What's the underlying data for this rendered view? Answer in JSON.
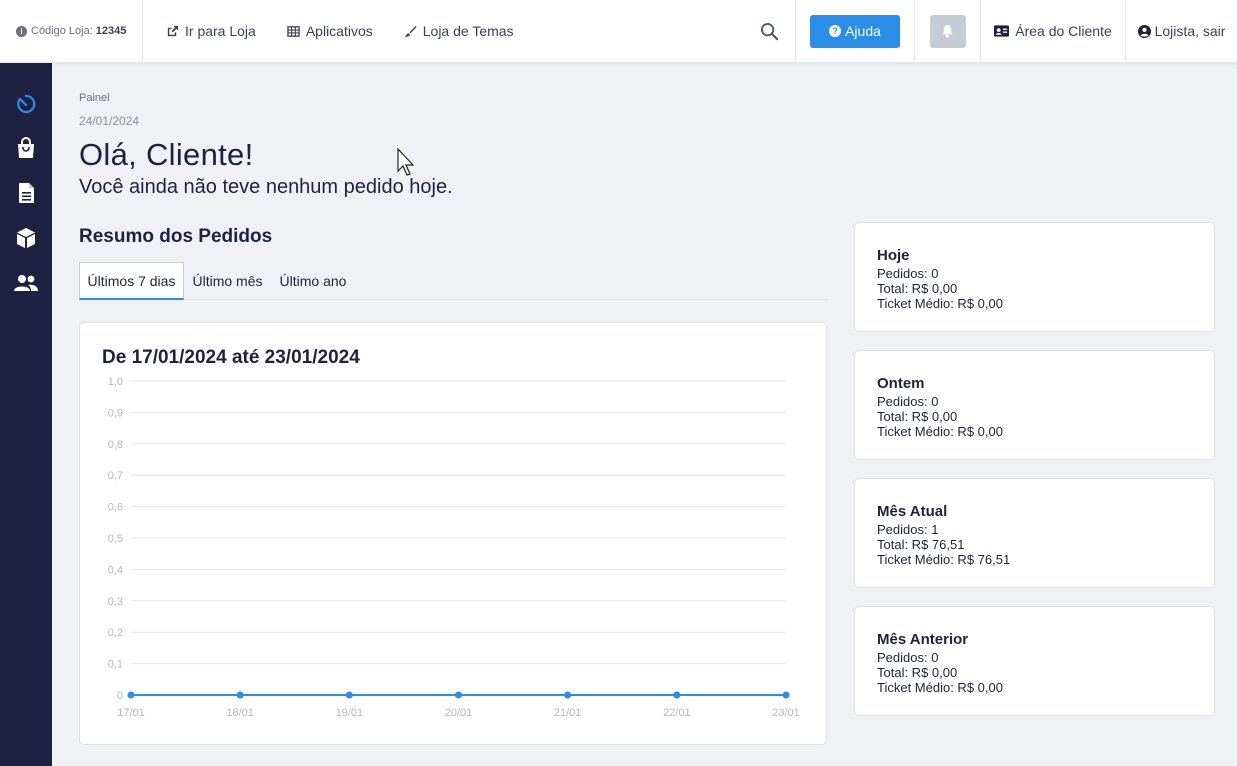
{
  "header": {
    "store_code_label": "Código Loja:",
    "store_code_value": "12345",
    "nav": [
      {
        "label": "Ir para Loja",
        "icon": "external-link-icon"
      },
      {
        "label": "Aplicativos",
        "icon": "grid-icon"
      },
      {
        "label": "Loja de Temas",
        "icon": "brush-icon"
      }
    ],
    "help_label": "Ajuda",
    "client_area_label": "Área do Cliente",
    "logout_label": "Lojista, sair"
  },
  "sidebar": {
    "items": [
      {
        "icon": "dashboard-icon",
        "active": true
      },
      {
        "icon": "shopping-bag-icon"
      },
      {
        "icon": "document-icon"
      },
      {
        "icon": "box-icon"
      },
      {
        "icon": "users-icon"
      }
    ]
  },
  "main": {
    "breadcrumb": "Painel",
    "date": "24/01/2024",
    "greeting": "Olá, Cliente!",
    "subtitle": "Você ainda não teve nenhum pedido hoje.",
    "section_title": "Resumo dos Pedidos",
    "tabs": [
      {
        "label": "Últimos 7 dias",
        "active": true
      },
      {
        "label": "Último mês"
      },
      {
        "label": "Último ano"
      }
    ]
  },
  "chart_data": {
    "type": "line",
    "title": "De 17/01/2024 até 23/01/2024",
    "categories": [
      "17/01",
      "18/01",
      "19/01",
      "20/01",
      "21/01",
      "22/01",
      "23/01"
    ],
    "series": [
      {
        "values": [
          0,
          0,
          0,
          0,
          0,
          0,
          0
        ]
      }
    ],
    "ylim": [
      0,
      1
    ],
    "yticks": [
      "0",
      "0,1",
      "0,2",
      "0,3",
      "0,4",
      "0,5",
      "0,6",
      "0,7",
      "0,8",
      "0,9",
      "1,0"
    ],
    "grid": true,
    "color": "#2a8ee8"
  },
  "stats": [
    {
      "title": "Hoje",
      "pedidos": "Pedidos: 0",
      "total": "Total: R$ 0,00",
      "ticket": "Ticket Médio: R$ 0,00"
    },
    {
      "title": "Ontem",
      "pedidos": "Pedidos: 0",
      "total": "Total: R$ 0,00",
      "ticket": "Ticket Médio: R$ 0,00"
    },
    {
      "title": "Mês Atual",
      "pedidos": "Pedidos: 1",
      "total": "Total: R$ 76,51",
      "ticket": "Ticket Médio: R$ 76,51"
    },
    {
      "title": "Mês Anterior",
      "pedidos": "Pedidos: 0",
      "total": "Total: R$ 0,00",
      "ticket": "Ticket Médio: R$ 0,00"
    }
  ],
  "colors": {
    "accent": "#2a8ee8",
    "sidebar": "#1f2142",
    "background": "#f0f1f5"
  }
}
